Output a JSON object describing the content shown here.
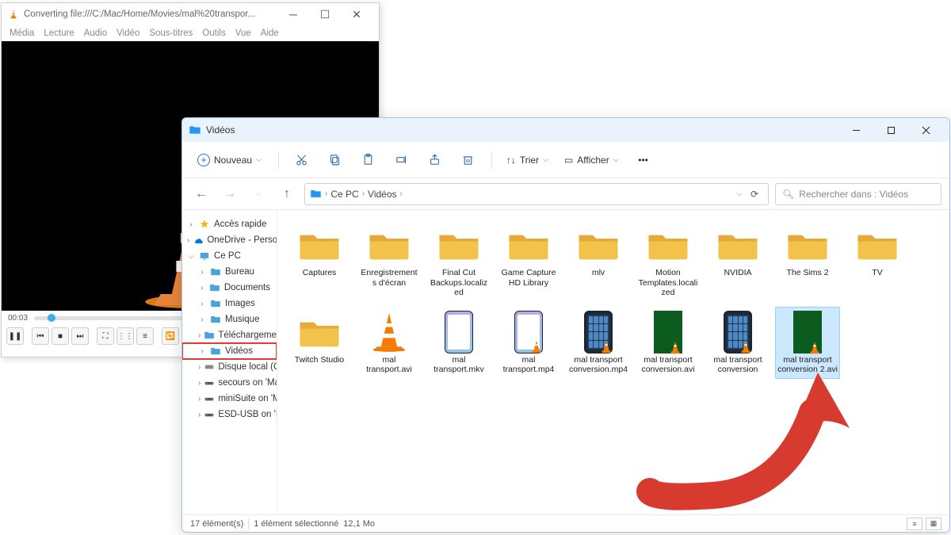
{
  "vlc": {
    "title": "Converting file:///C:/Mac/Home/Movies/mal%20transpor...",
    "menus": [
      "Média",
      "Lecture",
      "Audio",
      "Vidéo",
      "Sous-titres",
      "Outils",
      "Vue",
      "Aide"
    ],
    "time": "00:03"
  },
  "explorer": {
    "title": "Vidéos",
    "toolbar": {
      "new": "Nouveau",
      "sort": "Trier",
      "view": "Afficher"
    },
    "breadcrumb": [
      "Ce PC",
      "Vidéos"
    ],
    "search_placeholder": "Rechercher dans : Vidéos",
    "sidebar": [
      {
        "label": "Accès rapide",
        "icon": "star",
        "arrow": ">",
        "indent": false
      },
      {
        "label": "OneDrive - Perso",
        "icon": "onedrive",
        "arrow": ">",
        "indent": false
      },
      {
        "label": "Ce PC",
        "icon": "pc",
        "arrow": "v",
        "indent": false
      },
      {
        "label": "Bureau",
        "icon": "folder-blue",
        "arrow": ">",
        "indent": true
      },
      {
        "label": "Documents",
        "icon": "folder-blue",
        "arrow": ">",
        "indent": true
      },
      {
        "label": "Images",
        "icon": "folder-blue",
        "arrow": ">",
        "indent": true
      },
      {
        "label": "Musique",
        "icon": "folder-blue",
        "arrow": ">",
        "indent": true
      },
      {
        "label": "Téléchargement",
        "icon": "folder-blue",
        "arrow": ">",
        "indent": true
      },
      {
        "label": "Vidéos",
        "icon": "folder-blue",
        "arrow": ">",
        "indent": true,
        "highlight": true
      },
      {
        "label": "Disque local (C",
        "icon": "disk",
        "arrow": ">",
        "indent": true
      },
      {
        "label": "secours on 'Ma",
        "icon": "netdrive",
        "arrow": ">",
        "indent": true
      },
      {
        "label": "miniSuite on 'M",
        "icon": "netdrive",
        "arrow": ">",
        "indent": true
      },
      {
        "label": "ESD-USB on 'M",
        "icon": "netdrive",
        "arrow": ">",
        "indent": true
      }
    ],
    "files": [
      {
        "name": "Captures",
        "type": "folder"
      },
      {
        "name": "Enregistrements d'écran",
        "type": "folder"
      },
      {
        "name": "Final Cut Backups.localized",
        "type": "folder"
      },
      {
        "name": "Game Capture HD Library",
        "type": "folder"
      },
      {
        "name": "mlv",
        "type": "folder"
      },
      {
        "name": "Motion Templates.localized",
        "type": "folder"
      },
      {
        "name": "NVIDIA",
        "type": "folder"
      },
      {
        "name": "The Sims 2",
        "type": "folder"
      },
      {
        "name": "TV",
        "type": "folder"
      },
      {
        "name": "Twitch Studio",
        "type": "folder"
      },
      {
        "name": "mal transport.avi",
        "type": "vlc-cone"
      },
      {
        "name": "mal transport.mkv",
        "type": "phone-light"
      },
      {
        "name": "mal transport.mp4",
        "type": "phone-light-vlc"
      },
      {
        "name": "mal transport conversion.mp4",
        "type": "phone-dark-vlc"
      },
      {
        "name": "mal transport conversion.avi",
        "type": "green-vlc"
      },
      {
        "name": "mal transport conversion",
        "type": "phone-dark-vlc"
      },
      {
        "name": "mal transport conversion 2.avi",
        "type": "green-vlc",
        "selected": true
      }
    ],
    "status": {
      "count": "17 élément(s)",
      "selected": "1 élément sélectionné",
      "size": "12,1 Mo"
    }
  }
}
